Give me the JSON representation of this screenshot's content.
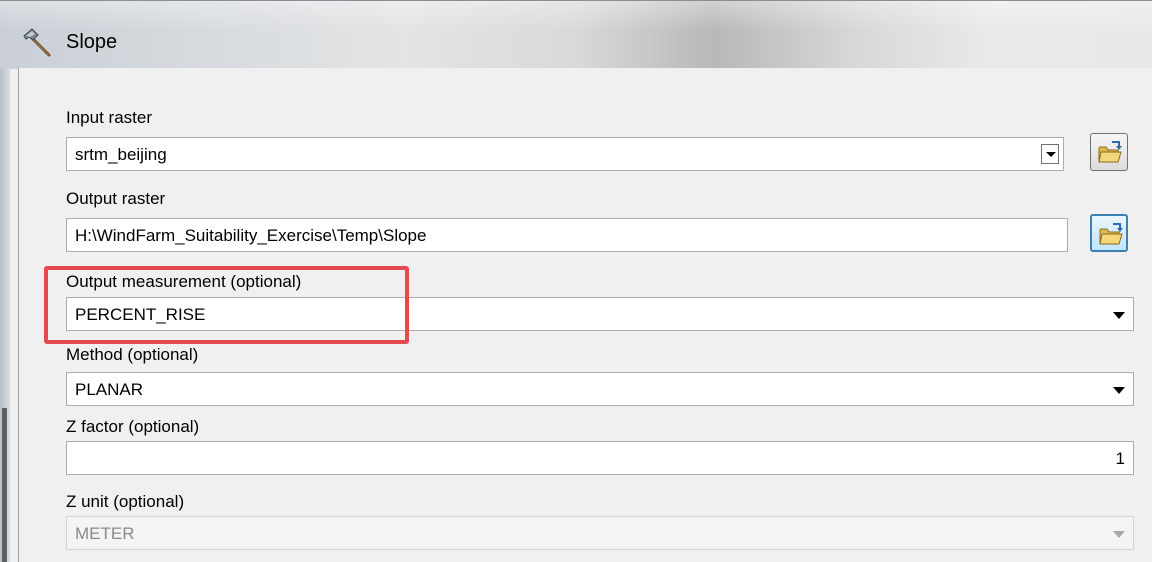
{
  "window": {
    "title": "Slope",
    "icon": "hammer-icon"
  },
  "form": {
    "input_raster": {
      "label": "Input raster",
      "value": "srtm_beijing",
      "browse_icon": "open-folder-icon"
    },
    "output_raster": {
      "label": "Output raster",
      "value": "H:\\WindFarm_Suitability_Exercise\\Temp\\Slope",
      "browse_icon": "open-folder-icon"
    },
    "output_measurement": {
      "label": "Output measurement (optional)",
      "value": "PERCENT_RISE",
      "highlighted": true
    },
    "method": {
      "label": "Method (optional)",
      "value": "PLANAR"
    },
    "z_factor": {
      "label": "Z factor (optional)",
      "value": "1"
    },
    "z_unit": {
      "label": "Z unit (optional)",
      "value": "METER",
      "disabled": true
    }
  },
  "colors": {
    "highlight": "#e5484d",
    "field_border": "#abadb3",
    "dialog_bg": "#f0f0f0"
  }
}
